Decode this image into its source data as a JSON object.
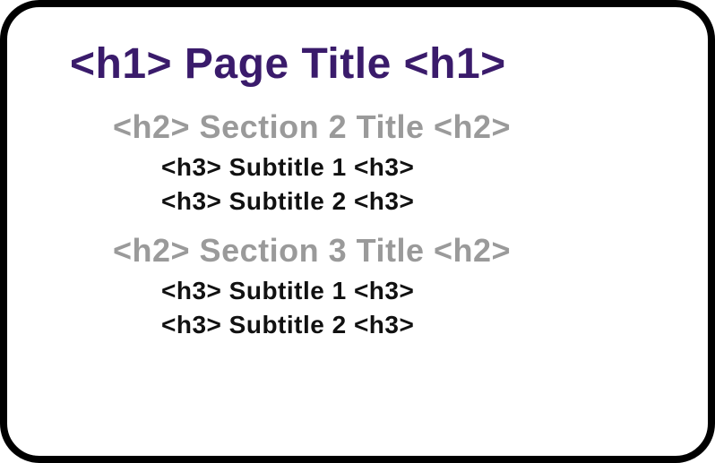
{
  "h1": "<h1> Page Title <h1>",
  "sections": [
    {
      "h2": "<h2> Section 2 Title <h2>",
      "h3a": "<h3> Subtitle 1 <h3>",
      "h3b": "<h3> Subtitle 2 <h3>"
    },
    {
      "h2": "<h2> Section 3 Title <h2>",
      "h3a": "<h3> Subtitle 1 <h3>",
      "h3b": "<h3> Subtitle 2 <h3>"
    }
  ]
}
